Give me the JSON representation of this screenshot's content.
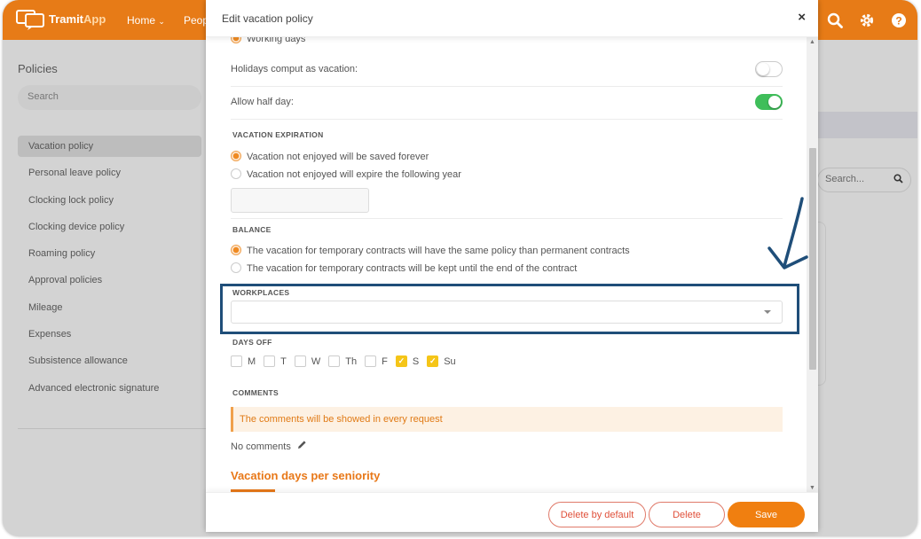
{
  "app": {
    "logo_text": "Tramit",
    "logo_text_accent": "App",
    "nav": [
      "Home",
      "Peop"
    ]
  },
  "sidebar": {
    "title": "Policies",
    "search_placeholder": "Search",
    "items": [
      {
        "label": "Vacation policy",
        "active": true
      },
      {
        "label": "Personal leave policy"
      },
      {
        "label": "Clocking lock policy"
      },
      {
        "label": "Clocking device policy"
      },
      {
        "label": "Roaming policy"
      },
      {
        "label": "Approval policies"
      },
      {
        "label": "Mileage"
      },
      {
        "label": "Expenses"
      },
      {
        "label": "Subsistence allowance"
      },
      {
        "label": "Advanced electronic signature"
      }
    ]
  },
  "background_right": {
    "search_placeholder": "Search..."
  },
  "modal": {
    "title": "Edit vacation policy",
    "close_label": "×",
    "working_days_label": "Working days",
    "holidays_label": "Holidays comput as vacation:",
    "holidays_toggle": false,
    "half_day_label": "Allow half day:",
    "half_day_toggle": true,
    "expiration": {
      "section": "VACATION EXPIRATION",
      "options": [
        {
          "label": "Vacation not enjoyed will be saved forever",
          "selected": true
        },
        {
          "label": "Vacation not enjoyed will expire the following year",
          "selected": false
        }
      ]
    },
    "balance": {
      "section": "BALANCE",
      "options": [
        {
          "label": "The vacation for temporary contracts will have the same policy than permanent contracts",
          "selected": true
        },
        {
          "label": "The vacation for temporary contracts will be kept until the end of the contract",
          "selected": false
        }
      ]
    },
    "workplaces": {
      "section": "WORKPLACES",
      "value": ""
    },
    "days_off": {
      "section": "DAYS OFF",
      "days": [
        {
          "label": "M",
          "checked": false
        },
        {
          "label": "T",
          "checked": false
        },
        {
          "label": "W",
          "checked": false
        },
        {
          "label": "Th",
          "checked": false
        },
        {
          "label": "F",
          "checked": false
        },
        {
          "label": "S",
          "checked": true
        },
        {
          "label": "Su",
          "checked": true
        }
      ]
    },
    "comments": {
      "section": "COMMENTS",
      "notice": "The comments will be showed in every request",
      "empty_text": "No comments"
    },
    "seniority_title": "Vacation days per seniority",
    "footer": {
      "delete_default_label": "Delete by default",
      "delete_label": "Delete",
      "save_label": "Save"
    }
  },
  "colors": {
    "brand": "#e77b17",
    "toggle_on": "#3fbe5a",
    "highlight": "#1f4e79",
    "checkbox_on": "#f5c518"
  }
}
